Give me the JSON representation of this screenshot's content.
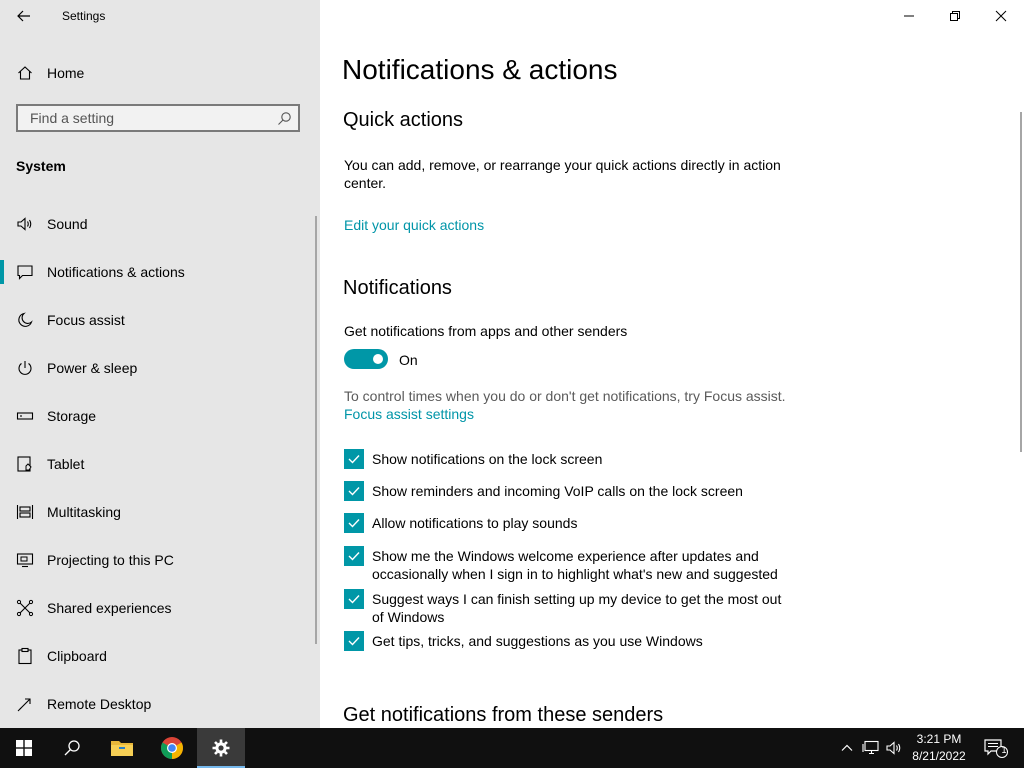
{
  "window": {
    "title": "Settings"
  },
  "sidebar": {
    "home_label": "Home",
    "search_placeholder": "Find a setting",
    "section_label": "System",
    "items": [
      {
        "label": "Sound",
        "icon": "speaker-icon"
      },
      {
        "label": "Notifications & actions",
        "icon": "notification-icon",
        "active": true
      },
      {
        "label": "Focus assist",
        "icon": "moon-icon"
      },
      {
        "label": "Power & sleep",
        "icon": "power-icon"
      },
      {
        "label": "Storage",
        "icon": "storage-icon"
      },
      {
        "label": "Tablet",
        "icon": "tablet-icon"
      },
      {
        "label": "Multitasking",
        "icon": "multitasking-icon"
      },
      {
        "label": "Projecting to this PC",
        "icon": "projecting-icon"
      },
      {
        "label": "Shared experiences",
        "icon": "shared-experiences-icon"
      },
      {
        "label": "Clipboard",
        "icon": "clipboard-icon"
      },
      {
        "label": "Remote Desktop",
        "icon": "remote-desktop-icon"
      }
    ]
  },
  "main": {
    "title": "Notifications & actions",
    "quick_actions": {
      "heading": "Quick actions",
      "description": "You can add, remove, or rearrange your quick actions directly in action center.",
      "edit_link": "Edit your quick actions"
    },
    "notifications": {
      "heading": "Notifications",
      "get_notifications_label": "Get notifications from apps and other senders",
      "toggle_state": "On",
      "toggle_on": true,
      "focus_text": "To control times when you do or don't get notifications, try Focus assist.",
      "focus_link": "Focus assist settings",
      "checkboxes": [
        {
          "label": "Show notifications on the lock screen",
          "checked": true
        },
        {
          "label": "Show reminders and incoming VoIP calls on the lock screen",
          "checked": true
        },
        {
          "label": "Allow notifications to play sounds",
          "checked": true
        },
        {
          "label": "Show me the Windows welcome experience after updates and occasionally when I sign in to highlight what's new and suggested",
          "checked": true
        },
        {
          "label": "Suggest ways I can finish setting up my device to get the most out of Windows",
          "checked": true
        },
        {
          "label": "Get tips, tricks, and suggestions as you use Windows",
          "checked": true
        }
      ]
    },
    "senders_heading": "Get notifications from these senders"
  },
  "taskbar": {
    "time": "3:21 PM",
    "date": "8/21/2022",
    "notification_count": "1"
  },
  "colors": {
    "accent": "#0097a7",
    "link": "#0095a8",
    "sidebar_bg": "#e6e6e6",
    "taskbar_bg": "#101010"
  }
}
